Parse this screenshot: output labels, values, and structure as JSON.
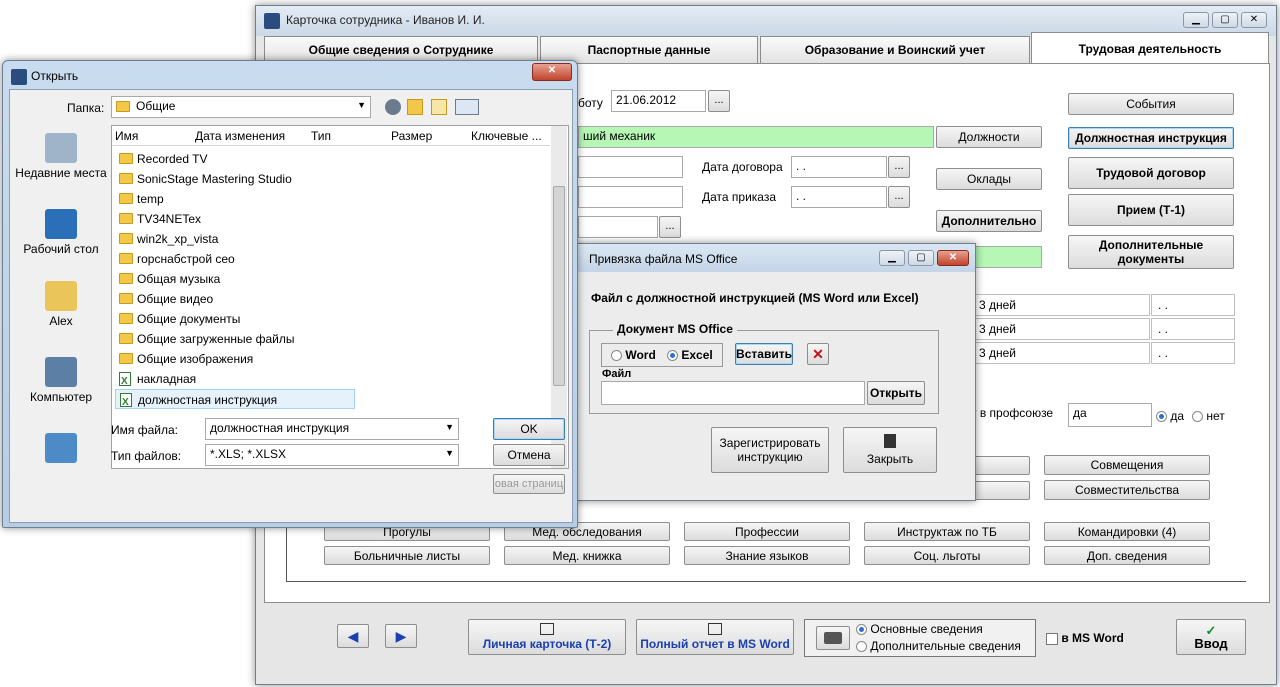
{
  "main_window": {
    "title": "Карточка сотрудника -  Иванов И. И.",
    "tabs": [
      "Общие сведения о Сотруднике",
      "Паспортные данные",
      "Образование и Воинский учет",
      "Трудовая деятельность"
    ],
    "hire_date_label": "боту",
    "hire_date": "21.06.2012",
    "position_value": "ший механик",
    "contract_date_label": "Дата договора",
    "order_date_label": "Дата приказа",
    "date_placeholder": " .  .",
    "dots": "...",
    "btn_positions": "Должности",
    "btn_salaries": "Оклады",
    "btn_extra": "Дополнительно",
    "btn_events": "События",
    "btn_job_instruction": "Должностная инструкция",
    "btn_labor_contract": "Трудовой  договор",
    "btn_hire": "Прием (Т-1)",
    "btn_additional_docs": "Дополнительные документы",
    "vacation_rows": [
      {
        "days": "3 дней",
        "date": " .  ."
      },
      {
        "days": "3 дней",
        "date": " .  ."
      },
      {
        "days": "3 дней",
        "date": " .  ."
      }
    ],
    "union_label": "т в профсоюзе",
    "union_value": "да",
    "radio_yes": "да",
    "radio_no": "нет",
    "btn_combination": "Совмещения",
    "btn_part_time": "Совместительства",
    "grid_row1": [
      "Прогулы",
      "Мед. обследования",
      "Профессии",
      "Инструктаж по ТБ",
      "Командировки (4)"
    ],
    "grid_row2": [
      "Больничные листы",
      "Мед. книжка",
      "Знание языков",
      "Соц. льготы",
      "Доп. сведения"
    ],
    "btn_personal_card": "Личная карточка (Т-2)",
    "btn_full_report": "Полный отчет в MS Word",
    "print_options": [
      "Основные сведения",
      "Дополнительные сведения"
    ],
    "in_ms_word": "в MS Word",
    "btn_enter": "Ввод"
  },
  "attach_dialog": {
    "title": "Привязка файла MS Office",
    "heading": "Файл с должностной инструкцией (MS Word или Excel)",
    "group_label": "Документ MS Office",
    "radio_word": "Word",
    "radio_excel": "Excel",
    "btn_insert": "Вставить",
    "file_label": "Файл",
    "file_value": "",
    "btn_open": "Открыть",
    "btn_register": "Зарегистрировать инструкцию",
    "btn_close": "Закрыть"
  },
  "open_dialog": {
    "title": "Открыть",
    "folder_label": "Папка:",
    "folder_value": "Общие",
    "places": [
      "Недавние места",
      "Рабочий стол",
      "Alex",
      "Компьютер",
      ""
    ],
    "columns": [
      "Имя",
      "Дата изменения",
      "Тип",
      "Размер",
      "Ключевые ..."
    ],
    "files": [
      {
        "name": "Recorded TV",
        "kind": "folder"
      },
      {
        "name": "SonicStage Mastering Studio",
        "kind": "folder"
      },
      {
        "name": "temp",
        "kind": "folder"
      },
      {
        "name": "TV34NETex",
        "kind": "folder"
      },
      {
        "name": "win2k_xp_vista",
        "kind": "folder"
      },
      {
        "name": "горснабстрой сео",
        "kind": "folder"
      },
      {
        "name": "Общая музыка",
        "kind": "folder"
      },
      {
        "name": "Общие видео",
        "kind": "folder"
      },
      {
        "name": "Общие документы",
        "kind": "folder"
      },
      {
        "name": "Общие загруженные файлы",
        "kind": "folder"
      },
      {
        "name": "Общие изображения",
        "kind": "folder"
      },
      {
        "name": "накладная",
        "kind": "xls"
      },
      {
        "name": "должностная инструкция",
        "kind": "xls"
      }
    ],
    "filename_label": "Имя файла:",
    "filename_value": "должностная инструкция",
    "filetype_label": "Тип файлов:",
    "filetype_value": "*.XLS; *.XLSX",
    "btn_ok": "OK",
    "btn_cancel": "Отмена",
    "btn_web": "овая страниц"
  },
  "colors": {
    "green_field": "#b6f7b6",
    "accent_blue": "#1a3fb0",
    "title_glass": "#c9dcef"
  }
}
